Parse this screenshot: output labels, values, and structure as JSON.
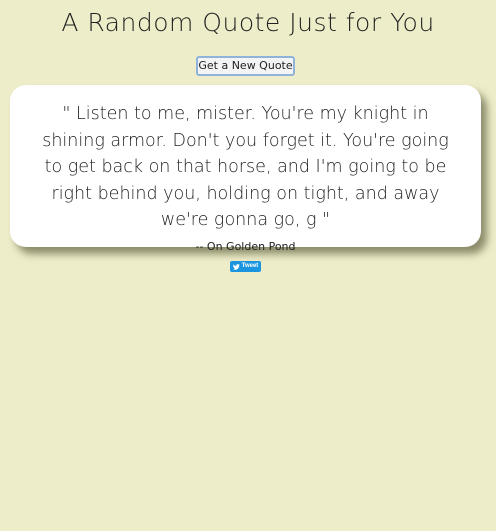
{
  "header": {
    "title": "A Random Quote Just for You"
  },
  "controls": {
    "new_quote_label": "Get a New Quote",
    "tweet_label": "Tweet",
    "tweet_icon": "twitter-bird-icon"
  },
  "quote": {
    "open_mark": "\"",
    "text": "Listen to me, mister. You're my knight in shining armor. Don't you forget it. You're going to get back on that horse, and I'm going to be right behind you, holding on tight, and away we're gonna go, g",
    "close_mark": "\"",
    "author": "-- On Golden Pond"
  },
  "colors": {
    "background": "#eeedc9",
    "card": "#ffffff",
    "tweet_button": "#1b95e0",
    "button_border": "#8fb3d9"
  }
}
